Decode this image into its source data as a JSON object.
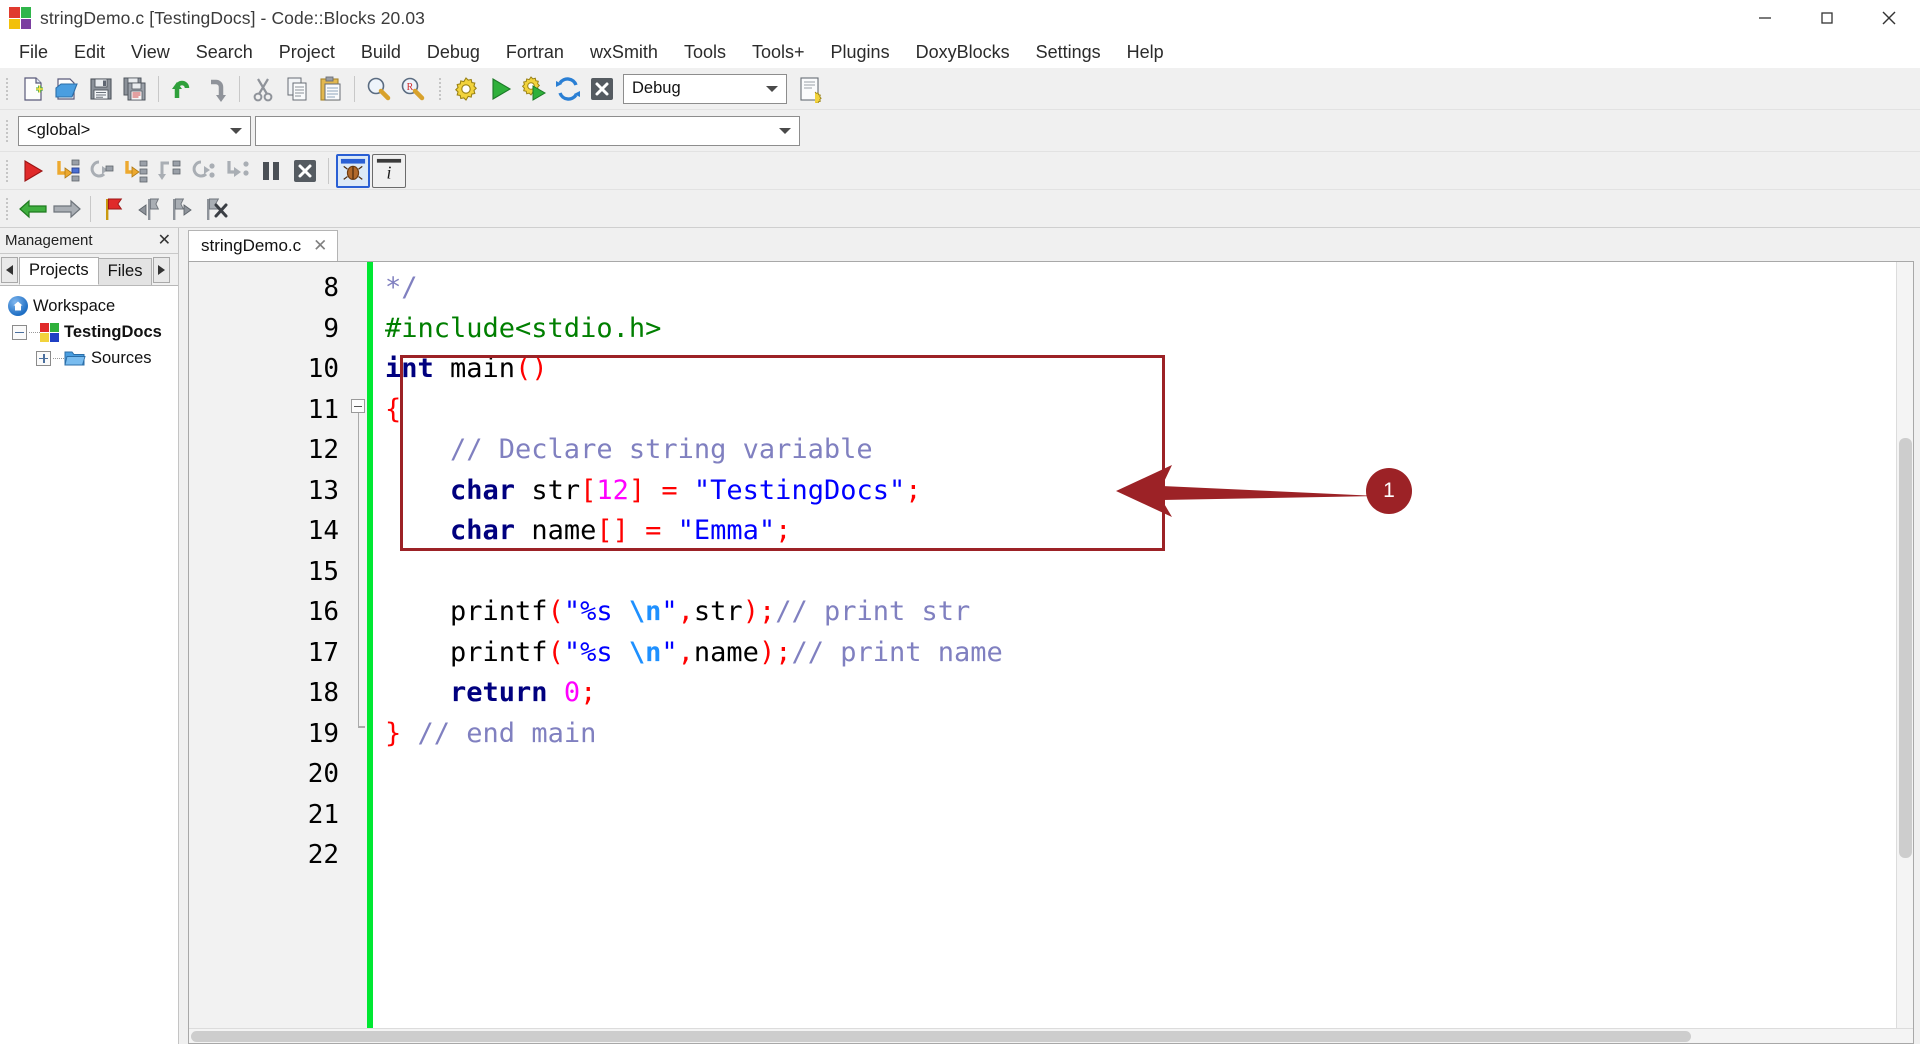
{
  "window": {
    "title": "stringDemo.c [TestingDocs] - Code::Blocks 20.03",
    "logo_name": "codeblocks-logo-icon",
    "buttons": [
      {
        "name": "minimize-button",
        "label": "—"
      },
      {
        "name": "maximize-button",
        "label": "□"
      },
      {
        "name": "close-button",
        "label": "✕"
      }
    ]
  },
  "menubar": {
    "items": [
      "File",
      "Edit",
      "View",
      "Search",
      "Project",
      "Build",
      "Debug",
      "Fortran",
      "wxSmith",
      "Tools",
      "Tools+",
      "Plugins",
      "DoxyBlocks",
      "Settings",
      "Help"
    ]
  },
  "toolbar_main": {
    "icons": [
      "new-file-icon",
      "open-file-icon",
      "save-icon",
      "save-all-icon",
      "undo-icon",
      "redo-icon",
      "cut-icon",
      "copy-icon",
      "paste-icon",
      "find-icon",
      "replace-icon"
    ]
  },
  "toolbar_build": {
    "icons": [
      "build-icon",
      "run-icon",
      "build-and-run-icon",
      "rebuild-icon",
      "abort-icon"
    ],
    "target_combo": {
      "value": "Debug",
      "name": "build-target-combo"
    },
    "icons_after": [
      "build-options-icon"
    ]
  },
  "toolbar_scope": {
    "scope_combo": {
      "value": "<global>",
      "name": "scope-combo"
    },
    "symbol_combo": {
      "value": "",
      "name": "symbol-combo"
    }
  },
  "toolbar_debug": {
    "icons": [
      "debug-continue-icon",
      "run-to-cursor-icon",
      "next-line-icon",
      "step-into-icon",
      "step-out-icon",
      "next-instruction-icon",
      "step-into-instruction-icon",
      "break-debugger-icon",
      "stop-debugger-icon"
    ],
    "icons_right": [
      "debugging-windows-icon",
      "various-info-icon"
    ]
  },
  "toolbar_nav": {
    "icons": [
      "back-icon",
      "forward-icon",
      "toggle-bookmark-icon",
      "previous-bookmark-icon",
      "next-bookmark-icon",
      "clear-bookmarks-icon"
    ]
  },
  "management": {
    "title": "Management",
    "close_label": "✕",
    "tabs": [
      {
        "label": "Projects",
        "active": true
      },
      {
        "label": "Files",
        "active": false
      }
    ],
    "tree": [
      {
        "label": "Workspace",
        "icon": "workspace-home-icon",
        "level": 1,
        "bold": false,
        "expander": "none"
      },
      {
        "label": "TestingDocs",
        "icon": "project-icon",
        "level": 2,
        "bold": true,
        "expander": "minus"
      },
      {
        "label": "Sources",
        "icon": "folder-icon",
        "level": 3,
        "bold": false,
        "expander": "plus"
      }
    ]
  },
  "editor": {
    "tab": {
      "label": "stringDemo.c",
      "close_label": "✕"
    },
    "first_line_number": 8,
    "lines": [
      {
        "n": "8",
        "tokens": [
          {
            "t": "*/",
            "c": "cmt"
          }
        ]
      },
      {
        "n": "9",
        "tokens": [
          {
            "t": "#include<stdio.h>",
            "c": "pre"
          }
        ]
      },
      {
        "n": "10",
        "tokens": [
          {
            "t": "int",
            "c": "k"
          },
          {
            "t": " main",
            "c": "id"
          },
          {
            "t": "()",
            "c": "op"
          }
        ]
      },
      {
        "n": "11",
        "tokens": [
          {
            "t": "{",
            "c": "op"
          }
        ]
      },
      {
        "n": "12",
        "tokens": [
          {
            "t": "    // Declare string variable",
            "c": "cmt"
          }
        ]
      },
      {
        "n": "13",
        "tokens": [
          {
            "t": "    ",
            "c": "id"
          },
          {
            "t": "char",
            "c": "k"
          },
          {
            "t": " str",
            "c": "id"
          },
          {
            "t": "[",
            "c": "op"
          },
          {
            "t": "12",
            "c": "num"
          },
          {
            "t": "] = ",
            "c": "op"
          },
          {
            "t": "\"TestingDocs\"",
            "c": "str"
          },
          {
            "t": ";",
            "c": "op"
          }
        ]
      },
      {
        "n": "14",
        "tokens": [
          {
            "t": "    ",
            "c": "id"
          },
          {
            "t": "char",
            "c": "k"
          },
          {
            "t": " name",
            "c": "id"
          },
          {
            "t": "[] = ",
            "c": "op"
          },
          {
            "t": "\"Emma\"",
            "c": "str"
          },
          {
            "t": ";",
            "c": "op"
          }
        ]
      },
      {
        "n": "15",
        "tokens": []
      },
      {
        "n": "16",
        "tokens": [
          {
            "t": "    printf",
            "c": "id"
          },
          {
            "t": "(",
            "c": "op"
          },
          {
            "t": "\"%s ",
            "c": "str"
          },
          {
            "t": "\\n",
            "c": "esc"
          },
          {
            "t": "\"",
            "c": "str"
          },
          {
            "t": ",",
            "c": "op"
          },
          {
            "t": "str",
            "c": "id"
          },
          {
            "t": ");",
            "c": "op"
          },
          {
            "t": "// print str",
            "c": "cmt"
          }
        ]
      },
      {
        "n": "17",
        "tokens": [
          {
            "t": "    printf",
            "c": "id"
          },
          {
            "t": "(",
            "c": "op"
          },
          {
            "t": "\"%s ",
            "c": "str"
          },
          {
            "t": "\\n",
            "c": "esc"
          },
          {
            "t": "\"",
            "c": "str"
          },
          {
            "t": ",",
            "c": "op"
          },
          {
            "t": "name",
            "c": "id"
          },
          {
            "t": ");",
            "c": "op"
          },
          {
            "t": "// print name",
            "c": "cmt"
          }
        ]
      },
      {
        "n": "18",
        "tokens": [
          {
            "t": "    ",
            "c": "id"
          },
          {
            "t": "return",
            "c": "k"
          },
          {
            "t": " ",
            "c": "id"
          },
          {
            "t": "0",
            "c": "num"
          },
          {
            "t": ";",
            "c": "op"
          }
        ]
      },
      {
        "n": "19",
        "tokens": [
          {
            "t": "}",
            "c": "op"
          },
          {
            "t": " ",
            "c": "id"
          },
          {
            "t": "// end main",
            "c": "cmt"
          }
        ]
      },
      {
        "n": "20",
        "tokens": []
      },
      {
        "n": "21",
        "tokens": []
      },
      {
        "n": "22",
        "tokens": []
      }
    ]
  },
  "annotations": {
    "highlight_box": {
      "name": "annotation-highlight-box"
    },
    "arrow": {
      "name": "annotation-arrow"
    },
    "badge": {
      "label": "1",
      "name": "annotation-badge-1"
    }
  },
  "colors": {
    "annotation": "#9c2226",
    "marker_bar": "#00e832",
    "keyword": "#00007f",
    "preprocessor": "#007f00",
    "comment": "#8080c0",
    "string": "#0000ff",
    "number": "#ff00ff",
    "operator": "#ff0000"
  }
}
